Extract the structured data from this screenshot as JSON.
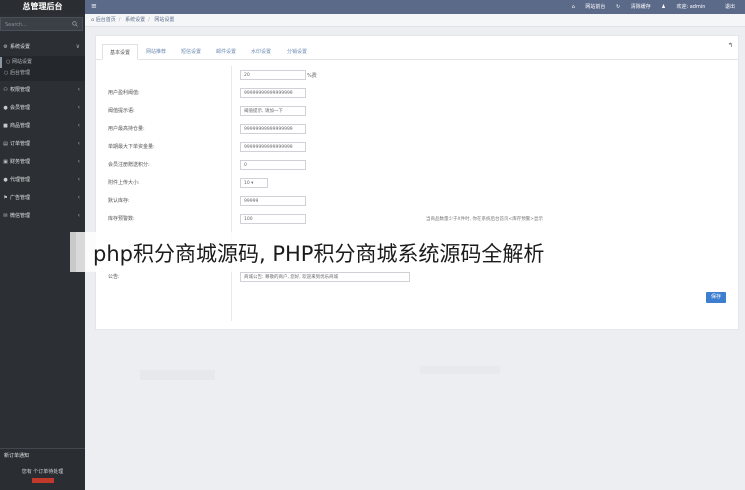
{
  "brand": "总管理后台",
  "search": {
    "placeholder": "Search..."
  },
  "sidebar": {
    "items": [
      {
        "icon": "gear-icon",
        "label": "系统设置",
        "chevron": "∨"
      },
      {
        "icon": "user-icon",
        "label": "权限管理",
        "chevron": "‹"
      },
      {
        "icon": "user-icon",
        "label": "会员管理",
        "chevron": "‹"
      },
      {
        "icon": "box-icon",
        "label": "商品管理",
        "chevron": "‹"
      },
      {
        "icon": "cart-icon",
        "label": "订单管理",
        "chevron": "‹"
      },
      {
        "icon": "file-icon",
        "label": "财务管理",
        "chevron": "‹"
      },
      {
        "icon": "user-icon",
        "label": "代理管理",
        "chevron": "‹"
      },
      {
        "icon": "flag-icon",
        "label": "广告管理",
        "chevron": "‹"
      },
      {
        "icon": "chat-icon",
        "label": "微信管理",
        "chevron": "‹"
      }
    ],
    "subitems": [
      {
        "label": "网站设置"
      },
      {
        "label": "后台管理"
      }
    ]
  },
  "notice": {
    "title": "新订单通知",
    "text": "您有   个订单待处理",
    "badge": ""
  },
  "topbar": {
    "menu_icon": "≡",
    "links": [
      "网站前台",
      "清除缓存",
      "欢迎: admin",
      "退出"
    ]
  },
  "breadcrumb": [
    "后台首页",
    "系统设置",
    "网站设置"
  ],
  "tabs": [
    "基本设置",
    "网站推荐",
    "短信设置",
    "邮件设置",
    "水印设置",
    "分销设置"
  ],
  "form": {
    "rows": [
      {
        "label": "",
        "value": "20",
        "unit": "%费",
        "hint": ""
      },
      {
        "label": "用户盈利阈值:",
        "value": "99999999999999999",
        "unit": "",
        "hint": ""
      },
      {
        "label": "阈值提示语:",
        "value": "阈值提示, 请加一下",
        "unit": "",
        "hint": ""
      },
      {
        "label": "用户最高持仓量:",
        "value": "99999999999999999",
        "unit": "",
        "hint": ""
      },
      {
        "label": "单期最大下单资金量:",
        "value": "99999999999999999",
        "unit": "",
        "hint": ""
      },
      {
        "label": "会员注册赠送积分:",
        "value": "0",
        "unit": "",
        "hint": ""
      },
      {
        "label": "附件上传大小:",
        "value": "10",
        "unit": "",
        "hint": ""
      },
      {
        "label": "默认库存:",
        "value": "99999",
        "unit": "",
        "hint": ""
      },
      {
        "label": "库存预警数:",
        "value": "100",
        "unit": "",
        "hint": "当商品数量少于X件时, 你在系统后台首页<库存预警>显示"
      }
    ],
    "notice_label": "公告:",
    "notice_value": "商城公告: 尊敬的商户, 您好, 欢迎来到优乐商城",
    "save_label": "保存"
  },
  "overlay_title": "php积分商城源码, PHP积分商城系统源码全解析"
}
